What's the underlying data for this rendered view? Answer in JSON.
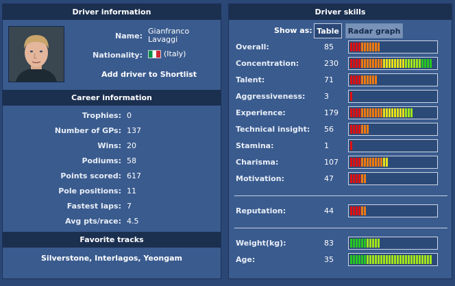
{
  "driver_info": {
    "header": "Driver information",
    "name_label": "Name:",
    "first_name": "Gianfranco",
    "last_name": "Lavaggi",
    "nationality_label": "Nationality:",
    "nationality": "(Italy)",
    "flag_icon": "italy-flag-icon",
    "shortlist_link": "Add driver to Shortlist"
  },
  "career": {
    "header": "Career information",
    "rows": [
      {
        "label": "Trophies:",
        "value": "0"
      },
      {
        "label": "Number of GPs:",
        "value": "137"
      },
      {
        "label": "Wins:",
        "value": "20"
      },
      {
        "label": "Podiums:",
        "value": "58"
      },
      {
        "label": "Points scored:",
        "value": "617"
      },
      {
        "label": "Pole positions:",
        "value": "11"
      },
      {
        "label": "Fastest laps:",
        "value": "7"
      },
      {
        "label": "Avg pts/race:",
        "value": "4.5"
      }
    ]
  },
  "favorite_tracks": {
    "header": "Favorite tracks",
    "tracks": "Silverstone, Interlagos, Yeongam"
  },
  "skills": {
    "header": "Driver skills",
    "show_as_label": "Show as:",
    "tab_table": "Table",
    "tab_radar": "Radar graph",
    "colors": {
      "red": "#e0100e",
      "orange": "#f07a10",
      "yellow": "#e8e21a",
      "green": "#28c820",
      "lightgreen": "#a2e61a"
    },
    "rows": [
      {
        "label": "Overall:",
        "value": "85",
        "segments": 11,
        "palette": "skill"
      },
      {
        "label": "Concentration:",
        "value": "230",
        "segments": 30,
        "palette": "skill"
      },
      {
        "label": "Talent:",
        "value": "71",
        "segments": 10,
        "palette": "skill"
      },
      {
        "label": "Aggressiveness:",
        "value": "3",
        "segments": 1,
        "palette": "skill"
      },
      {
        "label": "Experience:",
        "value": "179",
        "segments": 23,
        "palette": "skill"
      },
      {
        "label": "Technical insight:",
        "value": "56",
        "segments": 7,
        "palette": "skill"
      },
      {
        "label": "Stamina:",
        "value": "1",
        "segments": 1,
        "palette": "skill"
      },
      {
        "label": "Charisma:",
        "value": "107",
        "segments": 14,
        "palette": "skill"
      },
      {
        "label": "Motivation:",
        "value": "47",
        "segments": 6,
        "palette": "skill"
      }
    ],
    "reputation": {
      "label": "Reputation:",
      "value": "44",
      "segments": 6,
      "palette": "skill"
    },
    "physical": [
      {
        "label": "Weight(kg):",
        "value": "83",
        "segments": 11,
        "palette": "green"
      },
      {
        "label": "Age:",
        "value": "35",
        "segments": 30,
        "palette": "green"
      }
    ]
  }
}
